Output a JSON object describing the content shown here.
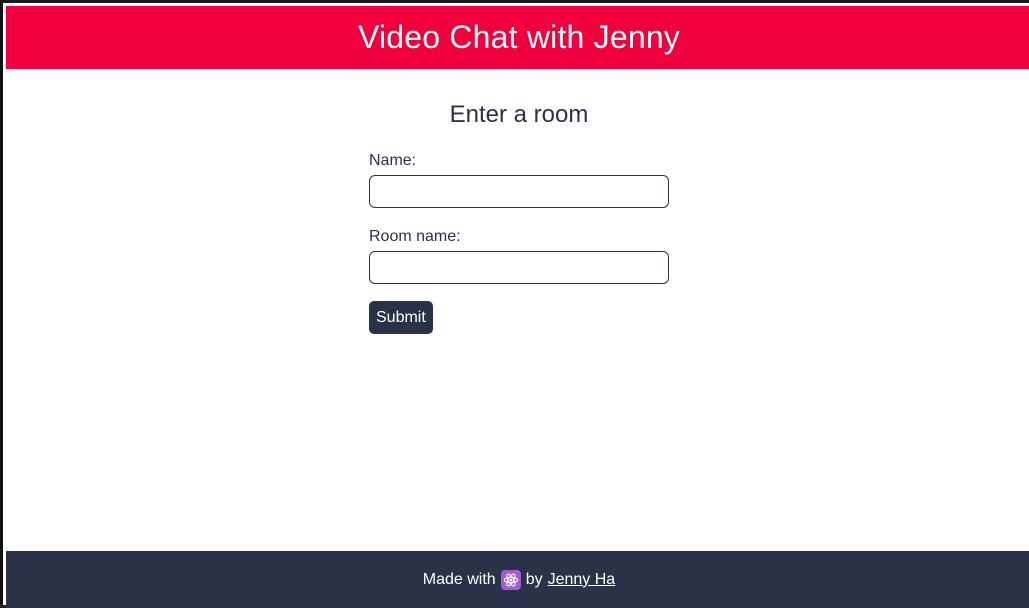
{
  "header": {
    "title": "Video Chat with Jenny"
  },
  "main": {
    "heading": "Enter a room",
    "name_label": "Name:",
    "name_value": "",
    "room_label": "Room name:",
    "room_value": "",
    "submit_label": "Submit"
  },
  "footer": {
    "made_with": "Made with",
    "icon": "react-atom-icon",
    "by": "by",
    "author_link": "Jenny Ha"
  },
  "colors": {
    "header_bg": "#f0003c",
    "footer_bg": "#2b3148",
    "button_bg": "#2b3148",
    "text": "#2b3148"
  }
}
